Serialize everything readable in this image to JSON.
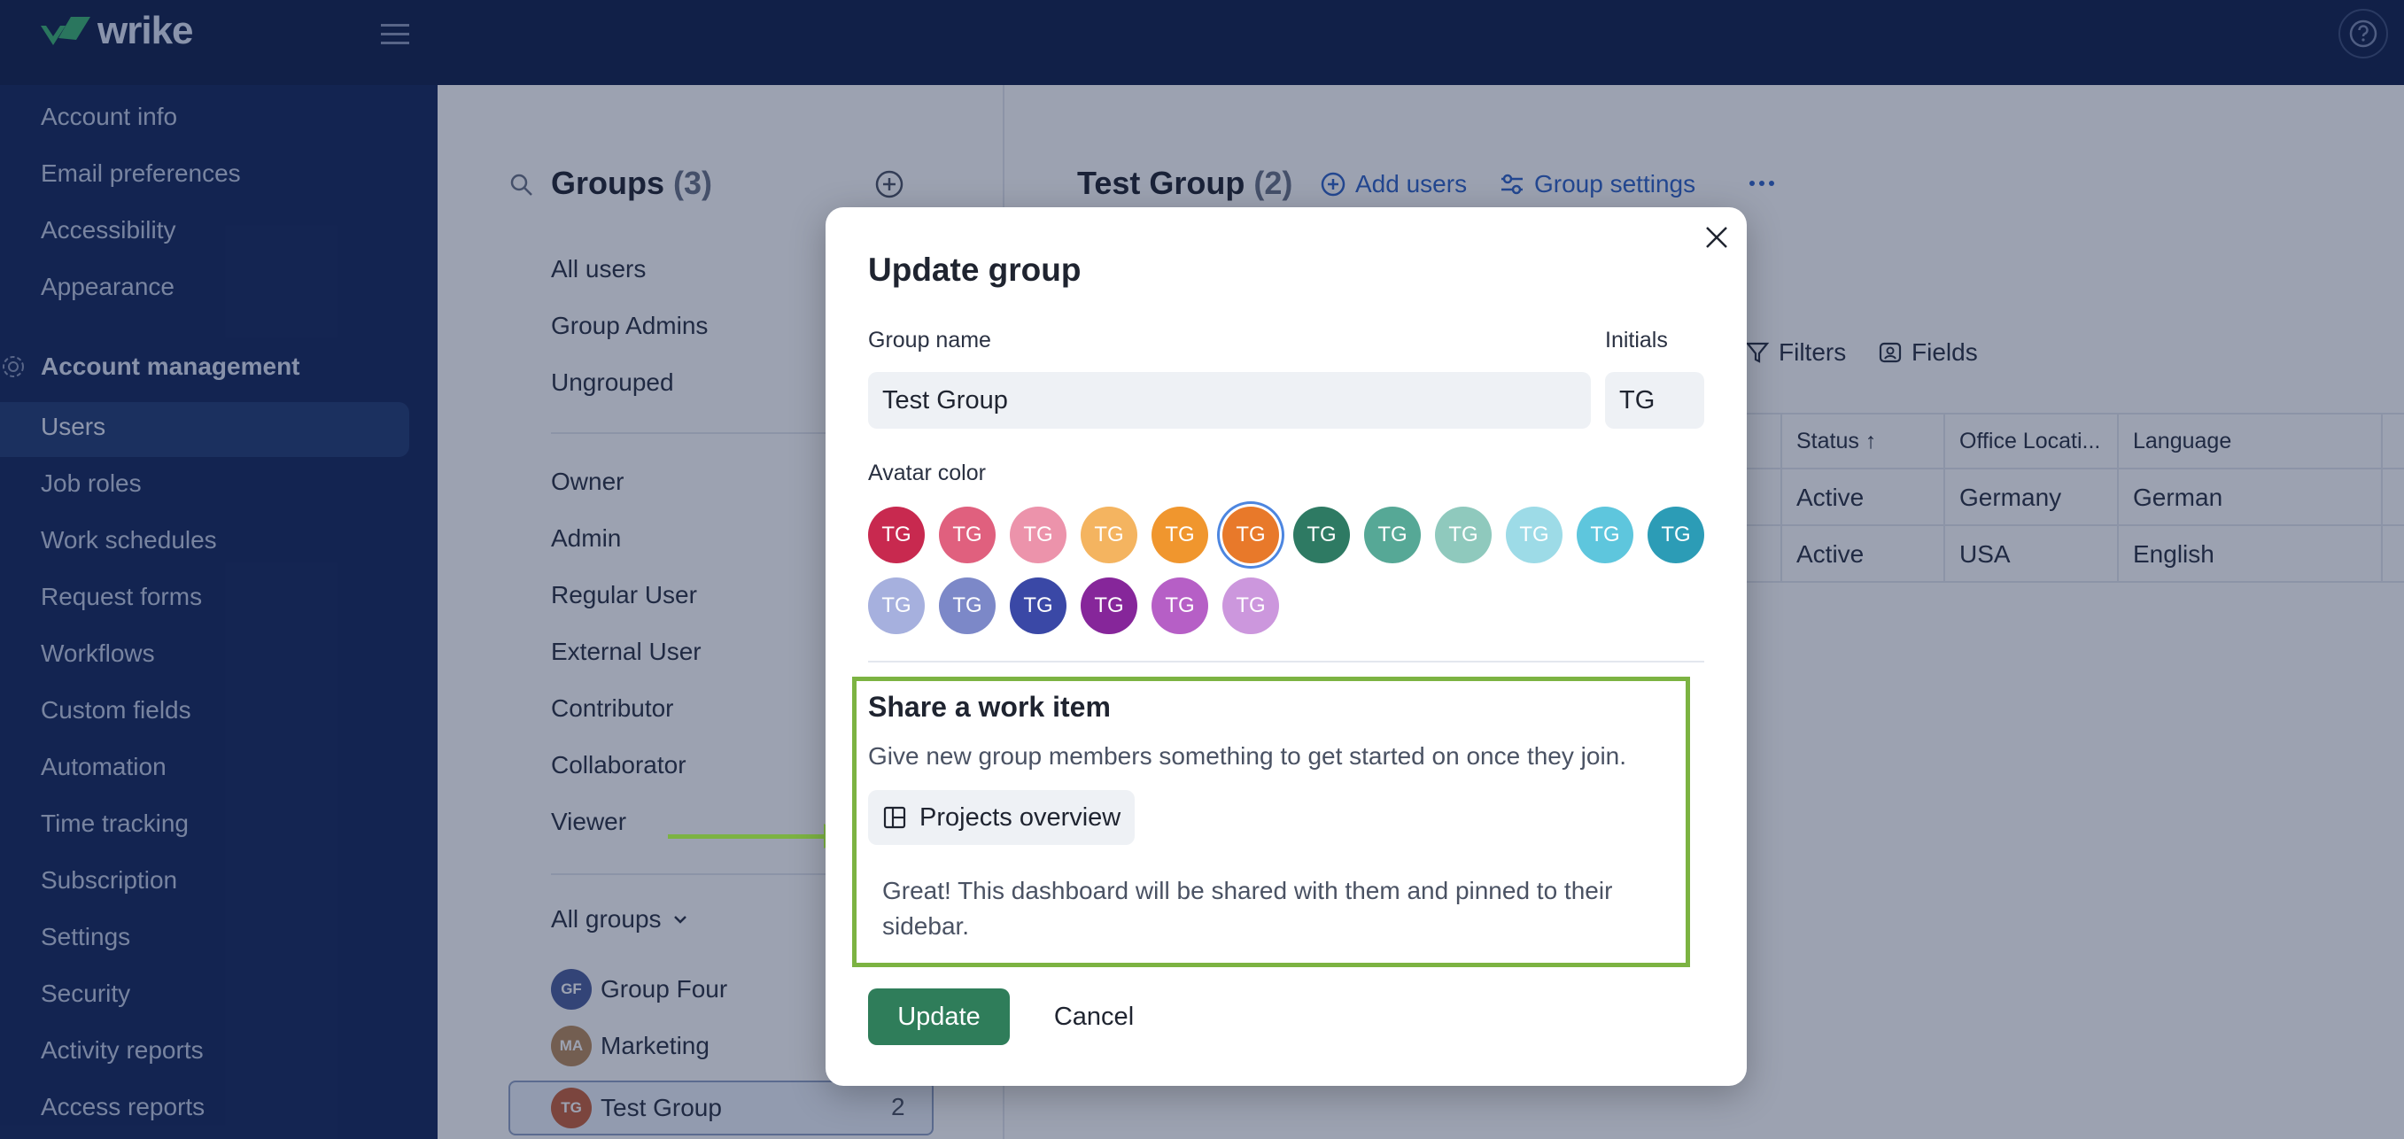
{
  "app": {
    "logo_text": "wrike"
  },
  "sidebar": {
    "items_top": [
      "Account info",
      "Email preferences",
      "Accessibility",
      "Appearance"
    ],
    "section_title": "Account management",
    "items": [
      "Users",
      "Job roles",
      "Work schedules",
      "Request forms",
      "Workflows",
      "Custom fields",
      "Automation",
      "Time tracking",
      "Subscription",
      "Settings",
      "Security",
      "Activity reports",
      "Access reports"
    ]
  },
  "groups_panel": {
    "title": "Groups",
    "count": "(3)",
    "items": [
      "All users",
      "Group Admins",
      "Ungrouped"
    ],
    "roles": [
      "Owner",
      "Admin",
      "Regular User",
      "External User",
      "Contributor",
      "Collaborator",
      "Viewer"
    ],
    "all_groups_label": "All groups",
    "groups": [
      {
        "initials": "GF",
        "name": "Group Four",
        "color": "#4b5d9c"
      },
      {
        "initials": "MA",
        "name": "Marketing",
        "color": "#b88a5a"
      },
      {
        "initials": "TG",
        "name": "Test Group",
        "color": "#c6603a",
        "count": "2"
      }
    ]
  },
  "group_detail": {
    "title": "Test Group",
    "count": "(2)",
    "add_users": "Add users",
    "group_settings": "Group settings",
    "filters": "Filters",
    "fields": "Fields",
    "columns": [
      "Status",
      "Office Locati...",
      "Language"
    ],
    "rows": [
      [
        "Active",
        "Germany",
        "German"
      ],
      [
        "Active",
        "USA",
        "English"
      ]
    ]
  },
  "modal": {
    "title": "Update group",
    "group_name_label": "Group name",
    "group_name_value": "Test Group",
    "initials_label": "Initials",
    "initials_value": "TG",
    "avatar_color_label": "Avatar color",
    "swatch_text": "TG",
    "colors": [
      "#c8294f",
      "#e0607e",
      "#ec93ab",
      "#f4b460",
      "#f0962e",
      "#e8792a",
      "#2e7a63",
      "#56a896",
      "#8fc9bd",
      "#9ddbe7",
      "#5ec6dd",
      "#2c9cb6",
      "#a6b0de",
      "#7c88c8",
      "#3a48a6",
      "#86269a",
      "#b65fc6",
      "#cc97dd"
    ],
    "selected_color": "#e8792a",
    "share_title": "Share a work item",
    "share_desc": "Give new group members something to get started on once they join.",
    "chip_label": "Projects overview",
    "note": "Great! This dashboard will be shared with them and pinned to their sidebar.",
    "update_label": "Update",
    "cancel_label": "Cancel"
  }
}
